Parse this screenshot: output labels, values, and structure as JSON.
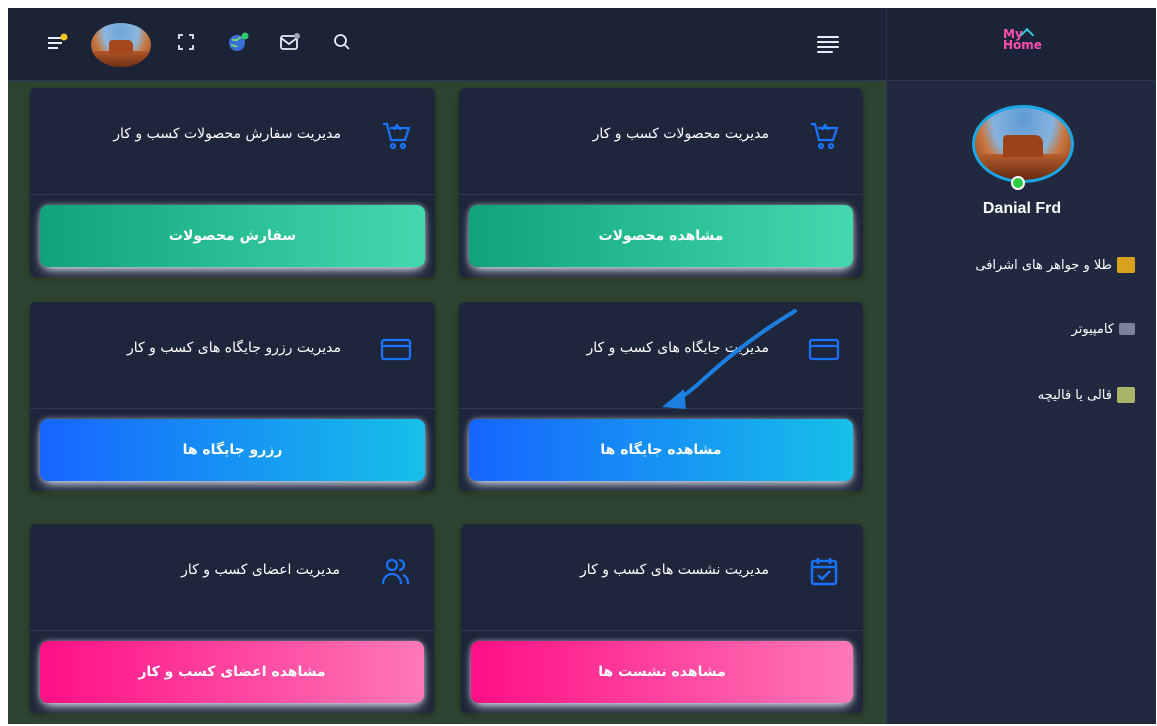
{
  "sidebar": {
    "user_name": "Danial Frd",
    "items": [
      {
        "label": "طلا و جواهر های اشرافی",
        "icon": "gold-jewelry-icon",
        "color": "#d9a21e"
      },
      {
        "label": "کامپیوتر",
        "icon": "computer-icon",
        "color": "#8a8fa6"
      },
      {
        "label": "قالی یا قالیچه",
        "icon": "carpet-icon",
        "color": "#a9b36a"
      }
    ],
    "logo": {
      "line1": "My",
      "line2": "Home"
    }
  },
  "header": {
    "icons": [
      "notification-menu-icon",
      "avatar",
      "fullscreen-icon",
      "globe-icon",
      "mail-icon",
      "search-icon",
      "menu-icon"
    ]
  },
  "cards": [
    {
      "title": "مدیریت محصولات کسب و کار",
      "button": "مشاهده محصولات",
      "icon": "cart-icon",
      "style": "green"
    },
    {
      "title": "مدیریت سفارش محصولات کسب و کار",
      "button": "سفارش محصولات",
      "icon": "cart-icon",
      "style": "green"
    },
    {
      "title": "مدیریت جایگاه های کسب و کار",
      "button": "مشاهده جایگاه ها",
      "icon": "card-icon",
      "style": "blue"
    },
    {
      "title": "مدیریت رزرو جایگاه های کسب و کار",
      "button": "رزرو جایگاه ها",
      "icon": "card-icon",
      "style": "blue"
    },
    {
      "title": "مدیریت نشست های کسب و کار",
      "button": "مشاهده نشست ها",
      "icon": "calendar-check-icon",
      "style": "pink"
    },
    {
      "title": "مدیریت اعضای کسب و کار",
      "button": "مشاهده اعضای کسب و کار",
      "icon": "users-icon",
      "style": "pink"
    }
  ],
  "colors": {
    "accent_blue": "#1a73ff",
    "header_bg": "#1b2436",
    "card_bg": "#1e263b",
    "content_bg": "#2e4330",
    "annotation_arrow": "#1c7fe0"
  }
}
